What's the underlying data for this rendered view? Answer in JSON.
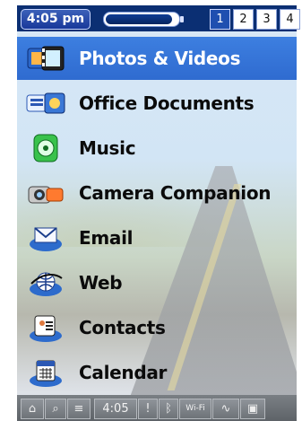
{
  "status_bar": {
    "time": "4:05 pm",
    "battery_level": 0.92,
    "pages": [
      "1",
      "2",
      "3",
      "4"
    ],
    "active_page": "1"
  },
  "launcher": {
    "items": [
      {
        "label": "Photos & Videos",
        "icon": "photos-videos-icon",
        "selected": true
      },
      {
        "label": "Office Documents",
        "icon": "office-documents-icon",
        "selected": false
      },
      {
        "label": "Music",
        "icon": "music-icon",
        "selected": false
      },
      {
        "label": "Camera Companion",
        "icon": "camera-companion-icon",
        "selected": false
      },
      {
        "label": "Email",
        "icon": "email-icon",
        "selected": false
      },
      {
        "label": "Web",
        "icon": "web-icon",
        "selected": false
      },
      {
        "label": "Contacts",
        "icon": "contacts-icon",
        "selected": false
      },
      {
        "label": "Calendar",
        "icon": "calendar-icon",
        "selected": false
      }
    ]
  },
  "bottom_bar": {
    "time": "4:05",
    "wifi_label": "Wi-Fi",
    "icons": [
      "home-icon",
      "search-icon",
      "menu-icon",
      "alert-icon",
      "bluetooth-icon",
      "wifi-icon",
      "signal-icon",
      "screen-icon"
    ]
  },
  "colors": {
    "top_bar": "#0b2f73",
    "selection": "#2f6bd0",
    "bottom_bar": "#6e7378"
  }
}
